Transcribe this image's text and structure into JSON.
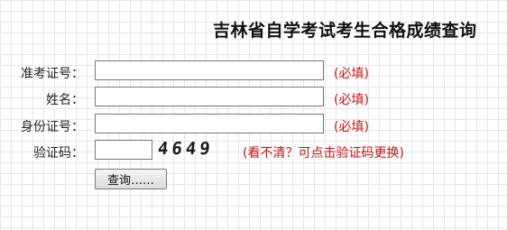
{
  "title": "吉林省自学考试考生合格成绩查询",
  "form": {
    "exam_no": {
      "label": "准考证号：",
      "value": "",
      "required_note": "(必填)"
    },
    "name": {
      "label": "姓名：",
      "value": "",
      "required_note": "(必填)"
    },
    "id_no": {
      "label": "身份证号：",
      "value": "",
      "required_note": "(必填)"
    },
    "captcha": {
      "label": "验证码：",
      "value": "",
      "image_text": "4649",
      "hint": "(看不清？可点击验证码更换)"
    },
    "submit_label": "查询……"
  }
}
